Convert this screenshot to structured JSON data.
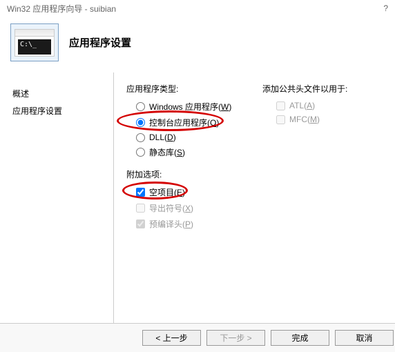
{
  "window": {
    "title": "Win32 应用程序向导 - suibian",
    "help_glyph": "?"
  },
  "header": {
    "title": "应用程序设置",
    "prompt_text": "C:\\_"
  },
  "sidebar": {
    "items": [
      {
        "label": "概述",
        "active": false
      },
      {
        "label": "应用程序设置",
        "active": true
      }
    ]
  },
  "main": {
    "app_type_label": "应用程序类型:",
    "app_types": [
      {
        "label": "Windows 应用程序",
        "accel": "W",
        "checked": false
      },
      {
        "label": "控制台应用程序",
        "accel": "O",
        "checked": true,
        "highlight": true
      },
      {
        "label": "DLL",
        "accel": "D",
        "checked": false
      },
      {
        "label": "静态库",
        "accel": "S",
        "checked": false
      }
    ],
    "extra_label": "附加选项:",
    "extras": [
      {
        "label": "空项目",
        "accel": "E",
        "checked": true,
        "enabled": true,
        "highlight": true
      },
      {
        "label": "导出符号",
        "accel": "X",
        "checked": false,
        "enabled": false
      },
      {
        "label": "预编译头",
        "accel": "P",
        "checked": true,
        "enabled": false
      }
    ],
    "headers_label": "添加公共头文件以用于:",
    "headers": [
      {
        "label": "ATL",
        "accel": "A",
        "checked": false,
        "enabled": false
      },
      {
        "label": "MFC",
        "accel": "M",
        "checked": false,
        "enabled": false
      }
    ]
  },
  "footer": {
    "prev": "< 上一步",
    "next": "下一步 >",
    "finish": "完成",
    "cancel": "取消"
  }
}
